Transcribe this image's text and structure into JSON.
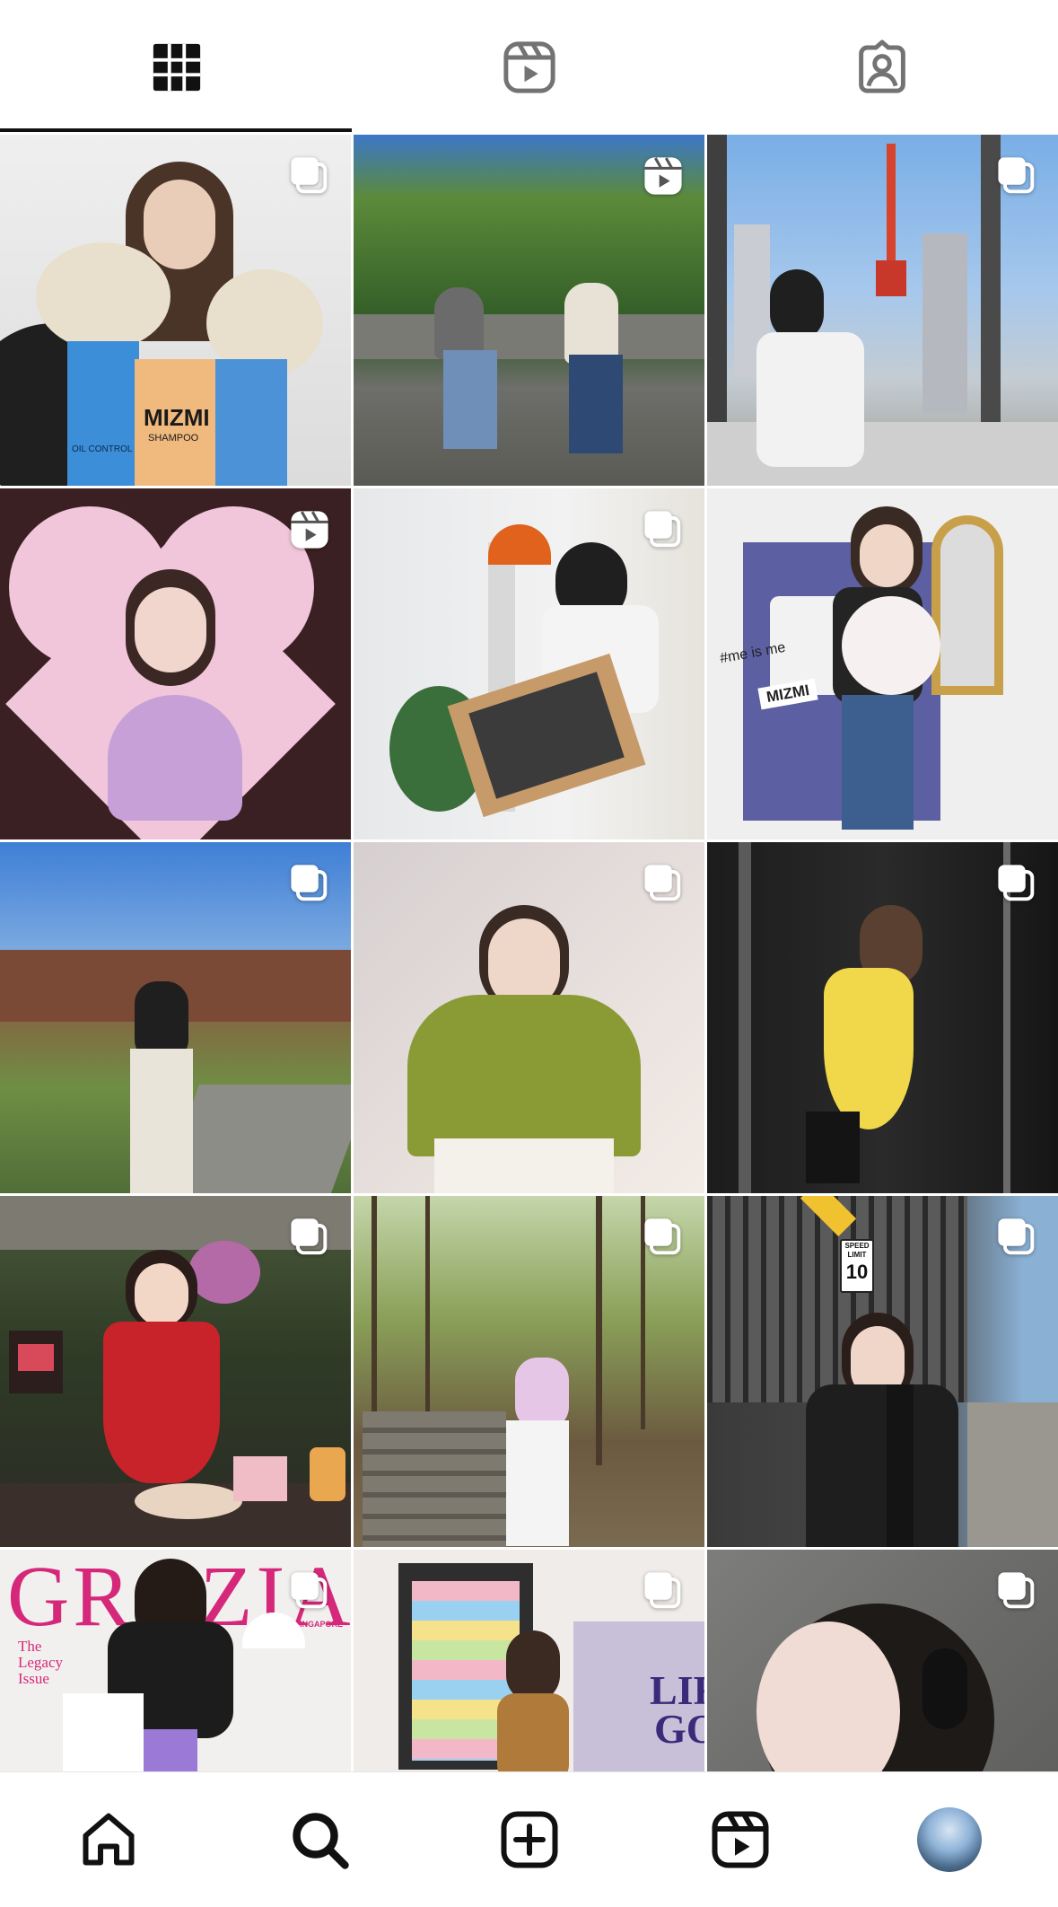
{
  "tabs": [
    {
      "id": "posts",
      "icon": "grid-icon",
      "active": true
    },
    {
      "id": "reels",
      "icon": "reels-icon",
      "active": false
    },
    {
      "id": "tagged",
      "icon": "tagged-person-icon",
      "active": false
    }
  ],
  "grid": {
    "posts": [
      {
        "badge": "carousel-icon",
        "text": [
          "MIZMI",
          "SHAMPOO",
          "OIL CONTROL"
        ]
      },
      {
        "badge": "reels-icon"
      },
      {
        "badge": "carousel-icon"
      },
      {
        "badge": "reels-icon"
      },
      {
        "badge": "carousel-icon"
      },
      {
        "badge": "carousel-icon",
        "text": [
          "#me is me",
          "MIZMI"
        ]
      },
      {
        "badge": "carousel-icon"
      },
      {
        "badge": "carousel-icon"
      },
      {
        "badge": "carousel-icon"
      },
      {
        "badge": "carousel-icon"
      },
      {
        "badge": "carousel-icon"
      },
      {
        "badge": "carousel-icon",
        "text": [
          "SPEED",
          "LIMIT",
          "10"
        ]
      },
      {
        "badge": "carousel-icon",
        "text": [
          "GRAZIA",
          "SINGAPORE",
          "The",
          "Legacy",
          "Issue"
        ]
      },
      {
        "badge": "carousel-icon",
        "text": [
          "LIFE",
          "GO"
        ]
      },
      {
        "badge": "carousel-icon"
      }
    ]
  },
  "bottom_nav": [
    {
      "id": "home",
      "icon": "home-icon"
    },
    {
      "id": "search",
      "icon": "search-icon"
    },
    {
      "id": "create",
      "icon": "create-post-icon"
    },
    {
      "id": "reels",
      "icon": "reels-icon"
    },
    {
      "id": "profile",
      "icon": "profile-avatar"
    }
  ]
}
